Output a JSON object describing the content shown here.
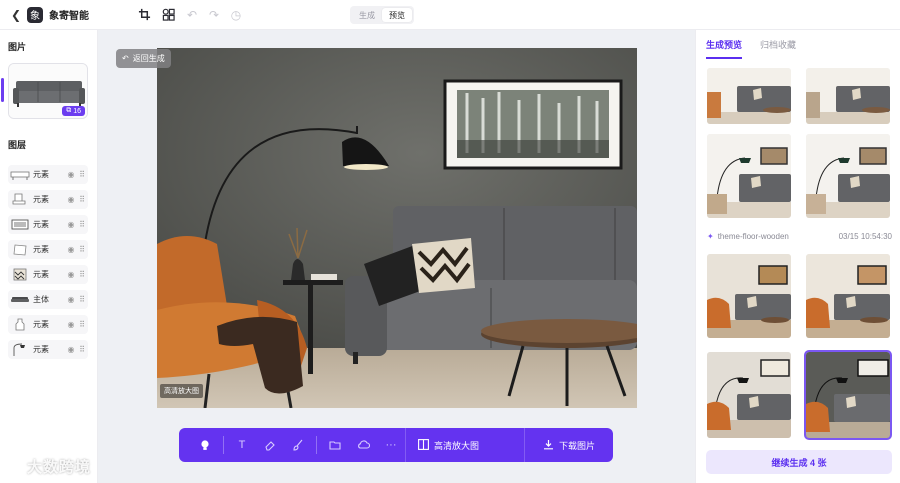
{
  "app": {
    "title": "象寄智能"
  },
  "mode_switch": {
    "options": [
      "生成",
      "预览"
    ],
    "active": "预览"
  },
  "left_panel": {
    "images_title": "图片",
    "badge_count": "16",
    "layers_title": "图层",
    "layers": [
      {
        "label": "元素",
        "icon": "rug-icon"
      },
      {
        "label": "元素",
        "icon": "chair-icon"
      },
      {
        "label": "元素",
        "icon": "painting-icon"
      },
      {
        "label": "元素",
        "icon": "pillow-icon"
      },
      {
        "label": "元素",
        "icon": "striped-pillow-icon"
      },
      {
        "label": "主体",
        "icon": "sofa-icon"
      },
      {
        "label": "元素",
        "icon": "vase-icon"
      },
      {
        "label": "元素",
        "icon": "lamp-icon"
      }
    ]
  },
  "canvas": {
    "back_button": "返回生成",
    "hd_tag": "高清放大图"
  },
  "bottom_toolbar": {
    "upscale_label": "高清放大图",
    "download_label": "下载图片"
  },
  "right_panel": {
    "tabs": [
      "生成预览",
      "归档收藏"
    ],
    "active_tab": "生成预览",
    "theme_name": "theme-floor-wooden",
    "timestamp": "03/15 10:54:30",
    "continue_button": "继续生成 4 张"
  },
  "watermark": "大数跨境",
  "colors": {
    "accent": "#6433f0",
    "accent_light": "#ece7fd"
  }
}
